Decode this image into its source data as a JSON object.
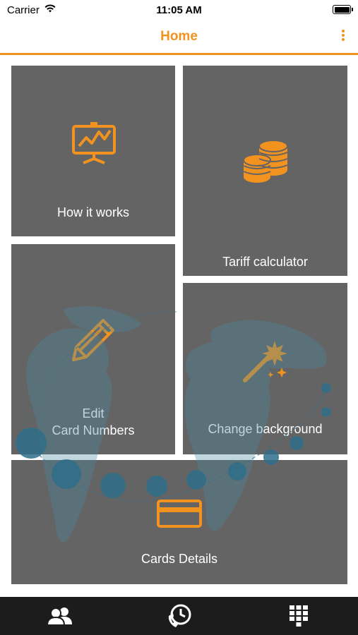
{
  "status_bar": {
    "carrier": "Carrier",
    "time": "11:05 AM"
  },
  "nav": {
    "title": "Home",
    "more_icon": "more-vertical-icon"
  },
  "tiles": {
    "how_it_works": {
      "label": "How it works",
      "icon": "presentation-chart-icon"
    },
    "tariff_calculator": {
      "label": "Tariff calculator",
      "icon": "coins-icon"
    },
    "edit_card_numbers": {
      "label_line1": "Edit",
      "label_line2": "Card Numbers",
      "icon": "pencil-icon"
    },
    "change_background": {
      "label": "Change background",
      "icon": "magic-wand-icon"
    },
    "cards_details": {
      "label": "Cards Details",
      "icon": "credit-card-icon"
    }
  },
  "tab_bar": {
    "tabs": [
      {
        "icon": "contacts-icon"
      },
      {
        "icon": "call-history-icon"
      },
      {
        "icon": "dialpad-icon"
      }
    ]
  },
  "colors": {
    "accent": "#f2921f",
    "tile_background": "#646464",
    "tab_bar_background": "#1c1c1c",
    "map_overlay": "#4a8aa3"
  }
}
